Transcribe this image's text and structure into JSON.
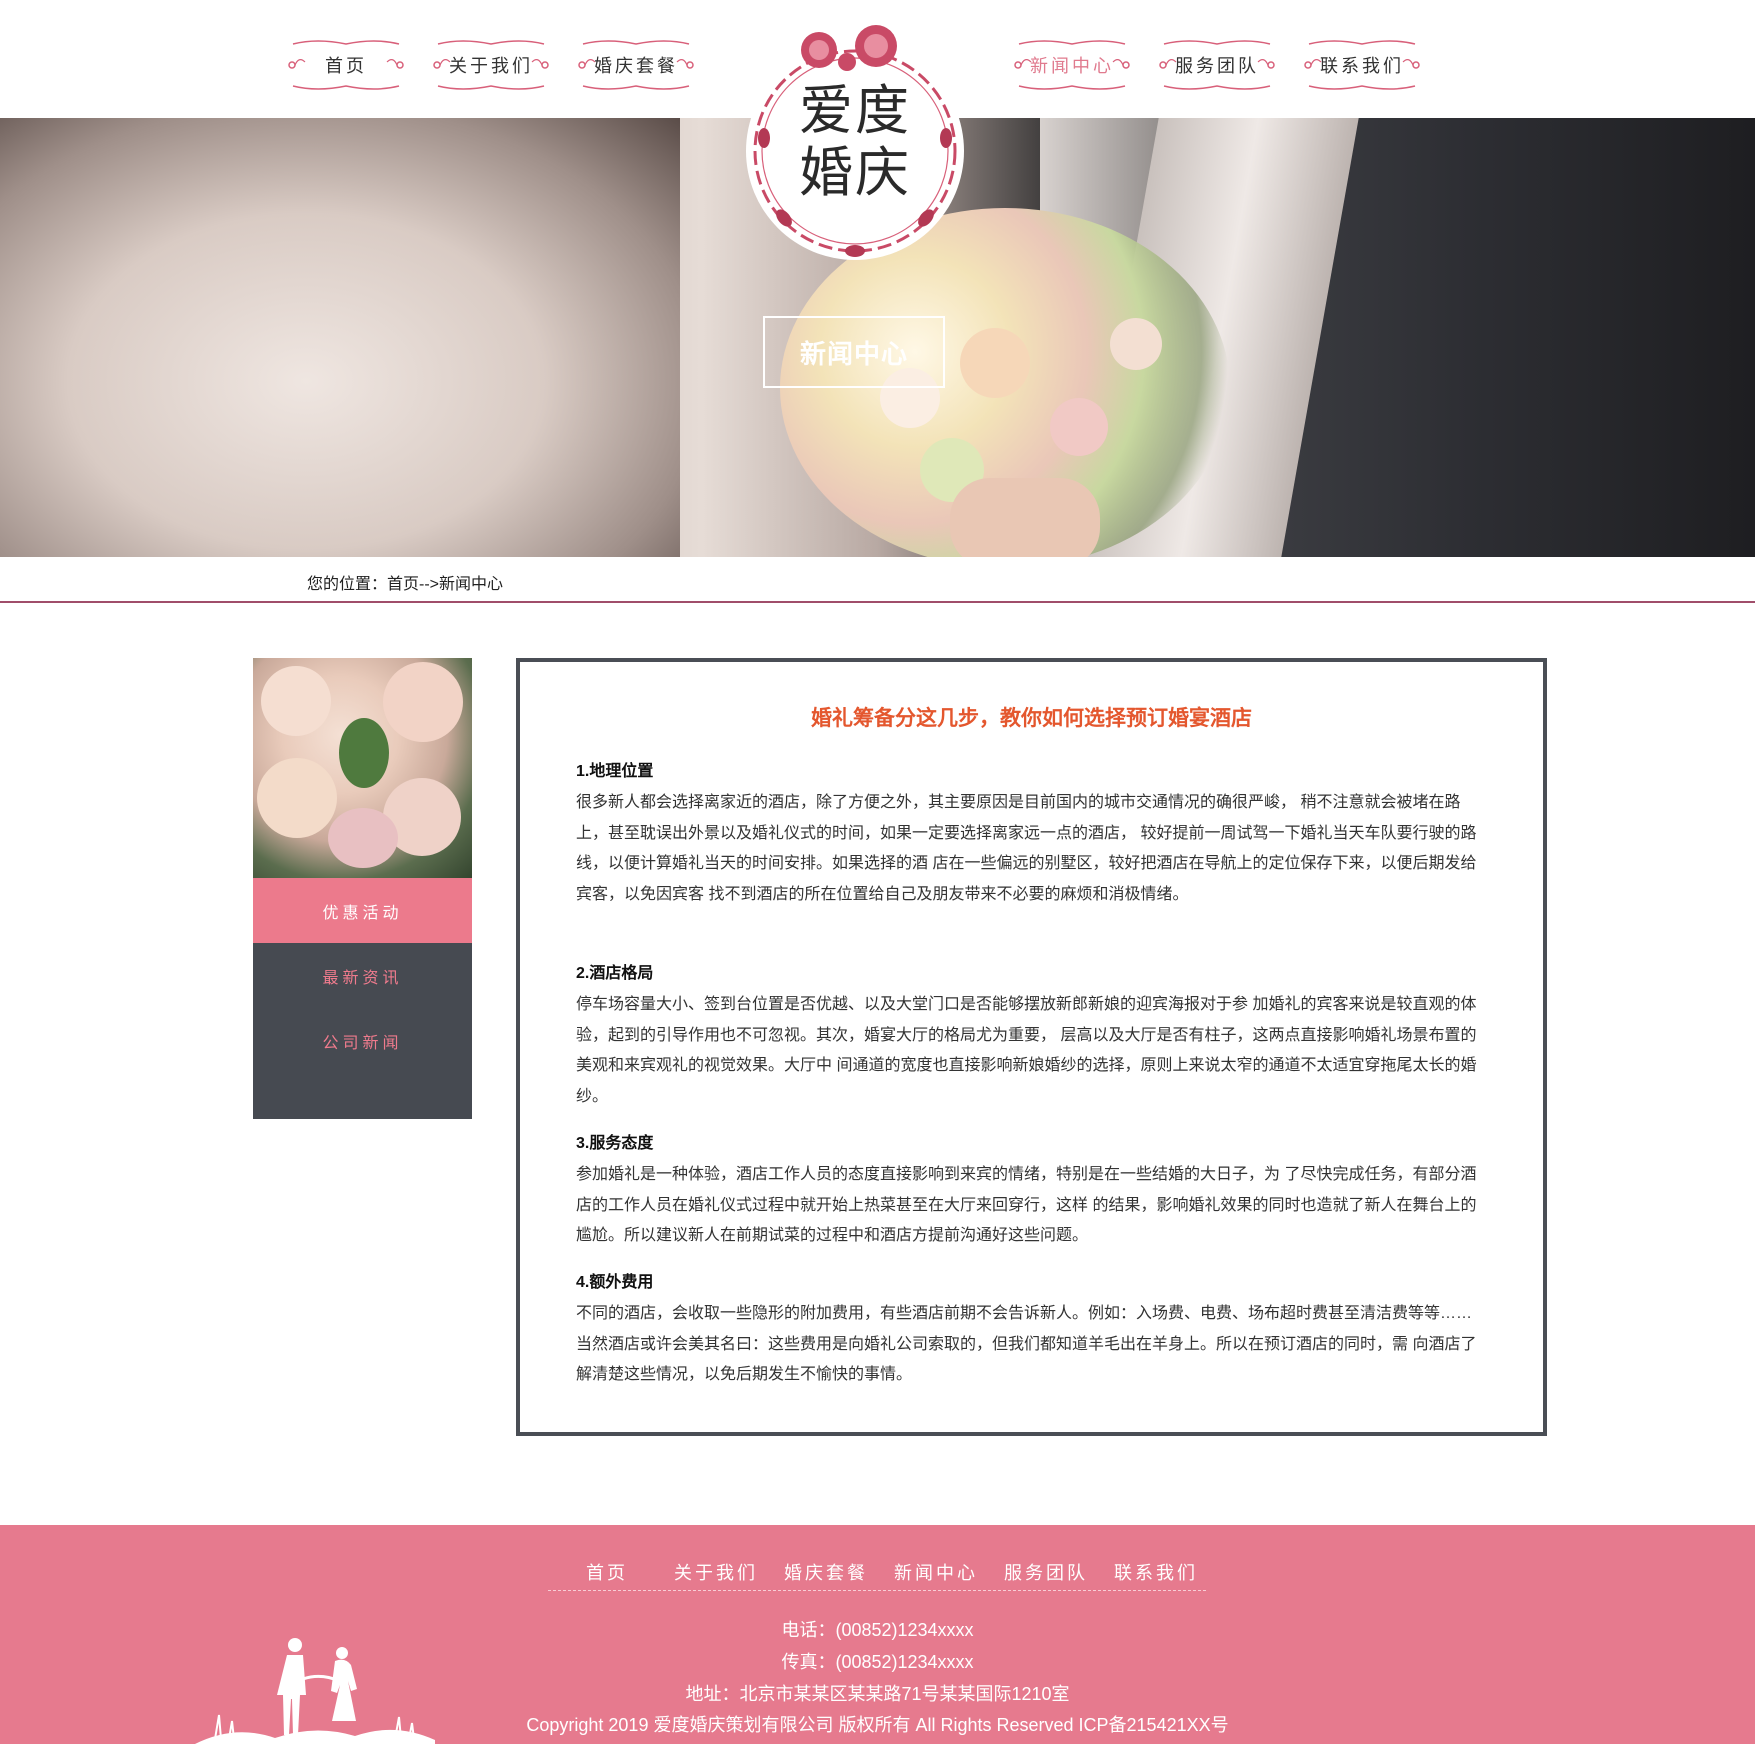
{
  "nav": {
    "left": [
      "首页",
      "关于我们",
      "婚庆套餐"
    ],
    "right": [
      "新闻中心",
      "服务团队",
      "联系我们"
    ]
  },
  "logo": {
    "text": "爱度婚庆"
  },
  "banner": {
    "title": "新闻中心"
  },
  "breadcrumb": {
    "text": "您的位置：首页-->新闻中心"
  },
  "sidebar": {
    "items": [
      "优惠活动",
      "最新资讯",
      "公司新闻"
    ],
    "active_index": 0
  },
  "article": {
    "title": "婚礼筹备分这几步，教你如何选择预订婚宴酒店",
    "sections": [
      {
        "heading": "1.地理位置",
        "body": "很多新人都会选择离家近的酒店，除了方便之外，其主要原因是目前国内的城市交通情况的确很严峻， 稍不注意就会被堵在路上，甚至耽误出外景以及婚礼仪式的时间，如果一定要选择离家远一点的酒店， 较好提前一周试驾一下婚礼当天车队要行驶的路线，以便计算婚礼当天的时间安排。如果选择的酒 店在一些偏远的别墅区，较好把酒店在导航上的定位保存下来，以便后期发给宾客，以免因宾客 找不到酒店的所在位置给自己及朋友带来不必要的麻烦和消极情绪。"
      },
      {
        "heading": "2.酒店格局",
        "body": "停车场容量大小、签到台位置是否优越、以及大堂门口是否能够摆放新郎新娘的迎宾海报对于参 加婚礼的宾客来说是较直观的体验，起到的引导作用也不可忽视。其次，婚宴大厅的格局尤为重要， 层高以及大厅是否有柱子，这两点直接影响婚礼场景布置的美观和来宾观礼的视觉效果。大厅中 间通道的宽度也直接影响新娘婚纱的选择，原则上来说太窄的通道不太适宜穿拖尾太长的婚纱。"
      },
      {
        "heading": "3.服务态度",
        "body": "参加婚礼是一种体验，酒店工作人员的态度直接影响到来宾的情绪，特别是在一些结婚的大日子，为 了尽快完成任务，有部分酒店的工作人员在婚礼仪式过程中就开始上热菜甚至在大厅来回穿行，这样 的结果，影响婚礼效果的同时也造就了新人在舞台上的尴尬。所以建议新人在前期试菜的过程中和酒店方提前沟通好这些问题。"
      },
      {
        "heading": "4.额外费用",
        "body": "不同的酒店，会收取一些隐形的附加费用，有些酒店前期不会告诉新人。例如：入场费、电费、场布超时费甚至清洁费等等…… 当然酒店或许会美其名曰：这些费用是向婚礼公司索取的，但我们都知道羊毛出在羊身上。所以在预订酒店的同时，需 向酒店了解清楚这些情况，以免后期发生不愉快的事情。"
      }
    ]
  },
  "footer": {
    "nav": [
      "首页",
      "关于我们",
      "婚庆套餐",
      "新闻中心",
      "服务团队",
      "联系我们"
    ],
    "phone": "电话：(00852)1234xxxx",
    "fax": "传真：(00852)1234xxxx",
    "address": "地址：北京市某某区某某路71号某某国际1210室",
    "copyright": "Copyright 2019 爱度婚庆策划有限公司 版权所有 All Rights Reserved ICP备215421XX号"
  },
  "colors": {
    "accent_pink": "#e67a8e",
    "article_title": "#e4572e",
    "sidebar_bg": "#464a51",
    "divider": "#a04e6a"
  }
}
